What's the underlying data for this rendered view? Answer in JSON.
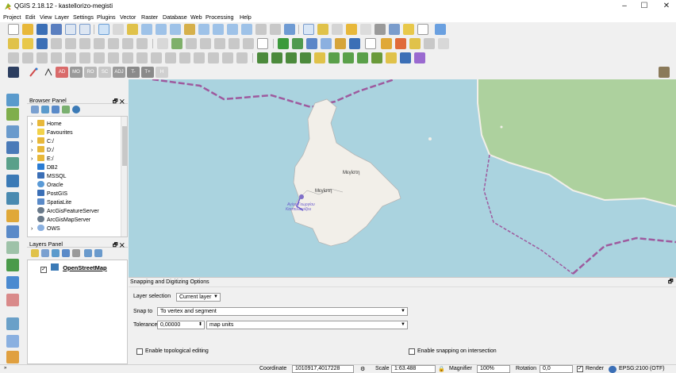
{
  "window": {
    "title": "QGIS 2.18.12 - kastellorizo-megisti",
    "min": "–",
    "max": "☐",
    "close": "✕"
  },
  "menu": [
    "Project",
    "Edit",
    "View",
    "Layer",
    "Settings",
    "Plugins",
    "Vector",
    "Raster",
    "Database",
    "Web",
    "Processing",
    "Help"
  ],
  "digitizing_toolbar": {
    "labels": [
      "AD",
      "MO",
      "RO",
      "SC",
      "ADJ",
      "T-",
      "T+",
      "H"
    ]
  },
  "browser_panel": {
    "title": "Browser Panel",
    "controls": "🗗 ✕",
    "items": [
      "Home",
      "Favourites",
      "C:/",
      "D:/",
      "E:/",
      "DB2",
      "MSSQL",
      "Oracle",
      "PostGIS",
      "SpatiaLite",
      "ArcGisFeatureServer",
      "ArcGisMapServer",
      "OWS"
    ]
  },
  "layers_panel": {
    "title": "Layers Panel",
    "controls": "🗗 ✕",
    "layers": [
      {
        "name": "OpenStreetMap",
        "checked": true
      }
    ]
  },
  "map": {
    "labels": [
      "Μεγίστη",
      "Μεγίστη",
      "Αγίου Γεωργίου",
      "Καστελλορίζου"
    ]
  },
  "snapping": {
    "title": "Snapping and Digitizing Options",
    "layer_selection_label": "Layer selection",
    "layer_selection_value": "Current layer",
    "snap_to_label": "Snap to",
    "snap_to_value": "To vertex and segment",
    "tolerance_label": "Tolerance",
    "tolerance_value": "0,00000",
    "tolerance_unit": "map units",
    "topological_editing": "Enable topological editing",
    "snapping_on_intersection": "Enable snapping on intersection"
  },
  "status": {
    "coordinate_label": "Coordinate",
    "coordinate_value": "1010917,4017228",
    "scale_label": "Scale",
    "scale_value": "1:63.488",
    "magnifier_label": "Magnifier",
    "magnifier_value": "100%",
    "rotation_label": "Rotation",
    "rotation_value": "0,0",
    "render_label": "Render",
    "crs": "EPSG:2100 (OTF)"
  },
  "colors": {
    "sea": "#aad3df",
    "land": "#f2efe9",
    "forest": "#add19e",
    "border": "#9e5a9e",
    "accent": "#2b7cd3"
  }
}
